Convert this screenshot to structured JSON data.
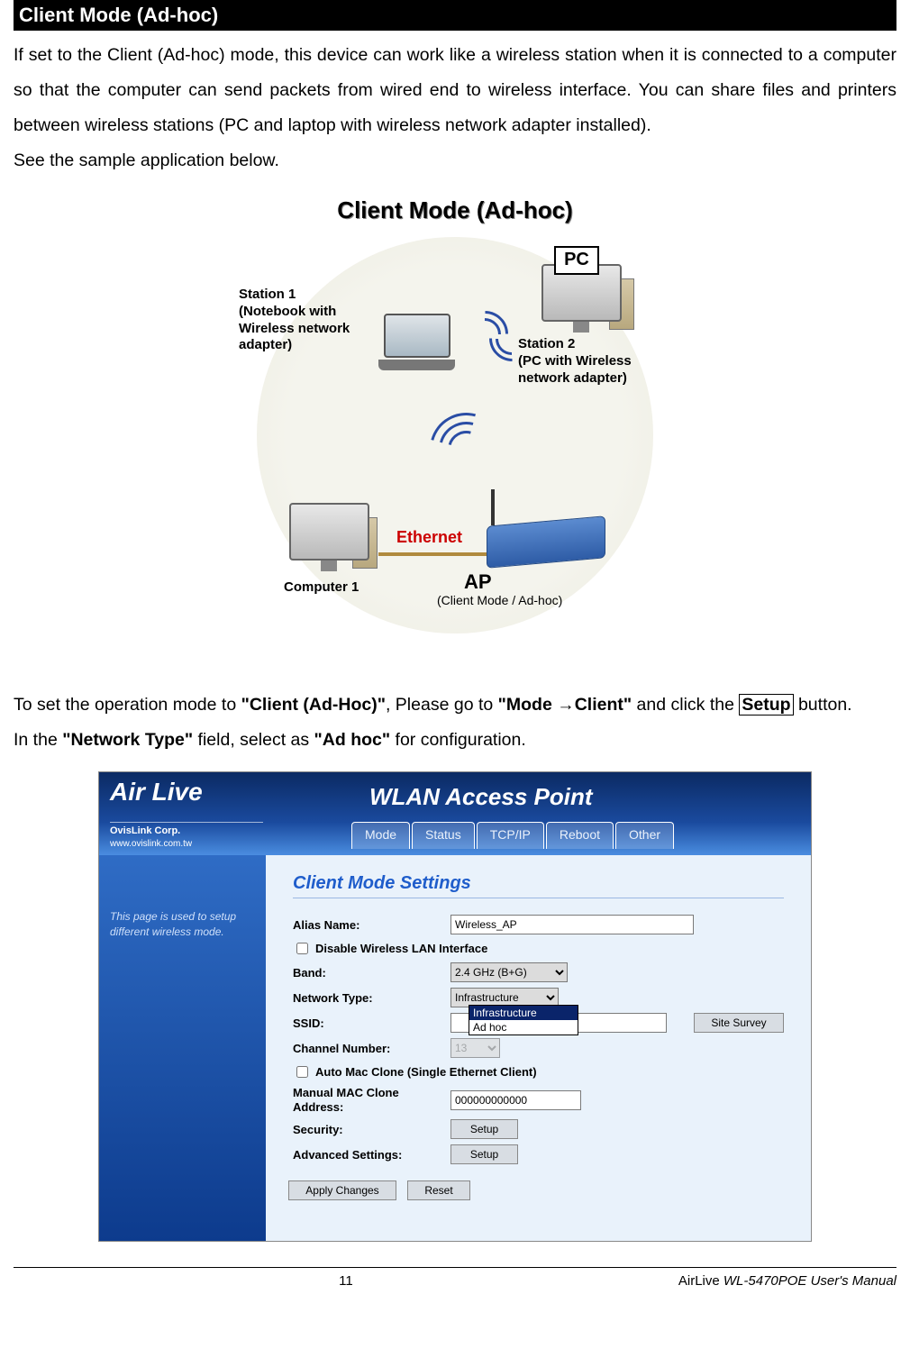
{
  "title_bar": "Client Mode (Ad-hoc)",
  "para1": "If set to the Client (Ad-hoc) mode, this device can work like a wireless station when it is connected to a computer so that the computer can send packets from wired end to wireless interface. You can share files and printers between wireless stations (PC and laptop with wireless network adapter installed).",
  "para1b": "See the sample application below.",
  "diagram1": {
    "title": "Client Mode (Ad-hoc)",
    "station1": "Station 1\n(Notebook with\nWireless network\nadapter)",
    "station2": "Station 2\n(PC with Wireless\nnetwork adapter)",
    "pc_badge": "PC",
    "computer1": "Computer 1",
    "ethernet": "Ethernet",
    "ap": "AP",
    "ap_sub": "(Client Mode / Ad-hoc)"
  },
  "para2_pre": "To set the operation mode to ",
  "para2_b1": "\"Client (Ad-Hoc)\"",
  "para2_mid1": ", Please go to ",
  "para2_b2": "\"Mode →Client\"",
  "para2_mid2": " and click the ",
  "para2_setup": "Setup",
  "para2_end": " button.",
  "para3_pre": "In the ",
  "para3_b1": "\"Network Type\"",
  "para3_mid": " field, select as ",
  "para3_b2": "\"Ad hoc\"",
  "para3_end": " for configuration.",
  "ui": {
    "brand": "Air Live",
    "brand_sub": "OvisLink Corp.",
    "brand_url": "www.ovislink.com.tw",
    "header_title": "WLAN Access Point",
    "tabs": [
      "Mode",
      "Status",
      "TCP/IP",
      "Reboot",
      "Other"
    ],
    "side_note": "This page is used to setup different wireless mode.",
    "section": "Client Mode Settings",
    "labels": {
      "alias": "Alias Name:",
      "disable_wlan": "Disable Wireless LAN Interface",
      "band": "Band:",
      "network_type": "Network Type:",
      "ssid": "SSID:",
      "channel": "Channel Number:",
      "auto_mac": "Auto Mac Clone (Single Ethernet Client)",
      "mac_clone": "Manual MAC Clone Address:",
      "security": "Security:",
      "advanced": "Advanced Settings:"
    },
    "values": {
      "alias": "Wireless_AP",
      "band": "2.4 GHz (B+G)",
      "network_type": "Infrastructure",
      "ssid": "",
      "channel": "13",
      "mac_clone": "000000000000"
    },
    "dropdown_options": [
      "Infrastructure",
      "Ad hoc"
    ],
    "buttons": {
      "site_survey": "Site Survey",
      "setup": "Setup",
      "apply": "Apply Changes",
      "reset": "Reset"
    }
  },
  "footer": {
    "page": "11",
    "book_pre": "AirLive ",
    "book_it": "WL-5470POE User's Manual"
  }
}
